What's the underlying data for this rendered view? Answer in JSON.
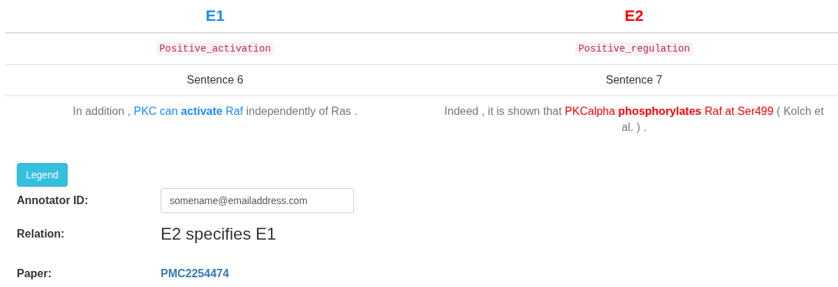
{
  "events": [
    {
      "title": "E1",
      "color": "#1a8cff",
      "type": "Positive_activation",
      "sentence_label": "Sentence 6",
      "sentence": [
        {
          "kind": "plain",
          "text": "In addition , "
        },
        {
          "kind": "entity",
          "text": "PKC can "
        },
        {
          "kind": "trigger",
          "text": "activate"
        },
        {
          "kind": "entity",
          "text": " Raf"
        },
        {
          "kind": "plain",
          "text": " independently of Ras ."
        }
      ]
    },
    {
      "title": "E2",
      "color": "#ff0000",
      "type": "Positive_regulation",
      "sentence_label": "Sentence 7",
      "sentence": [
        {
          "kind": "plain",
          "text": "Indeed , it is shown that "
        },
        {
          "kind": "entity",
          "text": "PKCalpha "
        },
        {
          "kind": "trigger",
          "text": "phosphorylates"
        },
        {
          "kind": "entity",
          "text": " Raf at Ser499"
        },
        {
          "kind": "plain",
          "text": " ( Kolch et al. ) ."
        }
      ]
    }
  ],
  "legend_button": "Legend",
  "form": [
    {
      "kind": "input",
      "label": "Annotator ID:",
      "value": "somename@emailaddress.com"
    },
    {
      "kind": "text",
      "label": "Relation:",
      "value": "E2 specifies E1"
    },
    {
      "kind": "link",
      "label": "Paper:",
      "value": "PMC2254474"
    }
  ]
}
